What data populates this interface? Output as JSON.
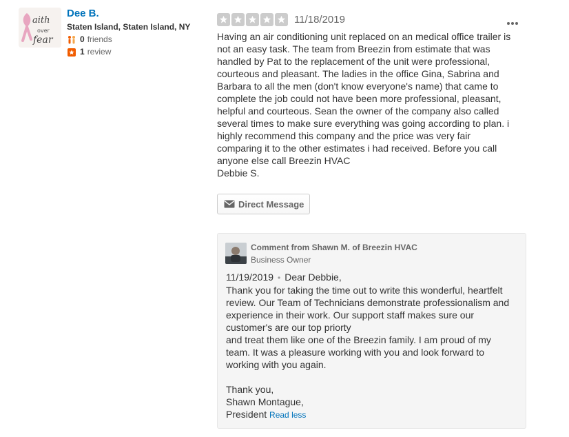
{
  "user": {
    "name": "Dee B.",
    "location": "Staten Island, Staten Island, NY",
    "friends_count": "0",
    "friends_label": "friends",
    "reviews_count": "1",
    "reviews_label": "review",
    "avatar_text": "faith over fear"
  },
  "review": {
    "rating": 5,
    "star_color": "#cccccc",
    "date": "11/18/2019",
    "text": "Having an air conditioning unit replaced on an medical office trailer is\nnot an easy task. The team from Breezin from estimate that was\nhandled by Pat to the replacement of the unit were professional,\ncourteous and pleasant.  The ladies in the office Gina, Sabrina and\nBarbara to all the men (don't know everyone's name) that came to\ncomplete the job could not have been more professional, pleasant,\nhelpful and courteous. Sean the owner of the company also called\nseveral times to make sure everything was going according to plan. i\nhighly recommend this company and the price was very fair\ncomparing it to the other estimates i had received. Before you call\nanyone else call Breezin HVAC\nDebbie S.",
    "dm_label": "Direct Message"
  },
  "business_reply": {
    "title": "Comment from Shawn M. of Breezin HVAC",
    "role": "Business Owner",
    "date": "11/19/2019",
    "separator": "•",
    "greeting": "Dear Debbie,",
    "text": "Thank you for taking the time out to write this wonderful, heartfelt\nreview. Our Team of Technicians demonstrate professionalism and\nexperience in their work.  Our support staff makes sure our\ncustomer's are our top priorty\nand treat them like one of  the Breezin family. I am proud of my\nteam.  It was a pleasure working with you and look forward to\nworking with you again.\n\nThank you,\nShawn Montague,\nPresident",
    "read_less": "Read less"
  },
  "colors": {
    "link": "#0073bb",
    "accent_orange": "#f15c00",
    "avatar_ribbon": "#e8a6c0"
  }
}
